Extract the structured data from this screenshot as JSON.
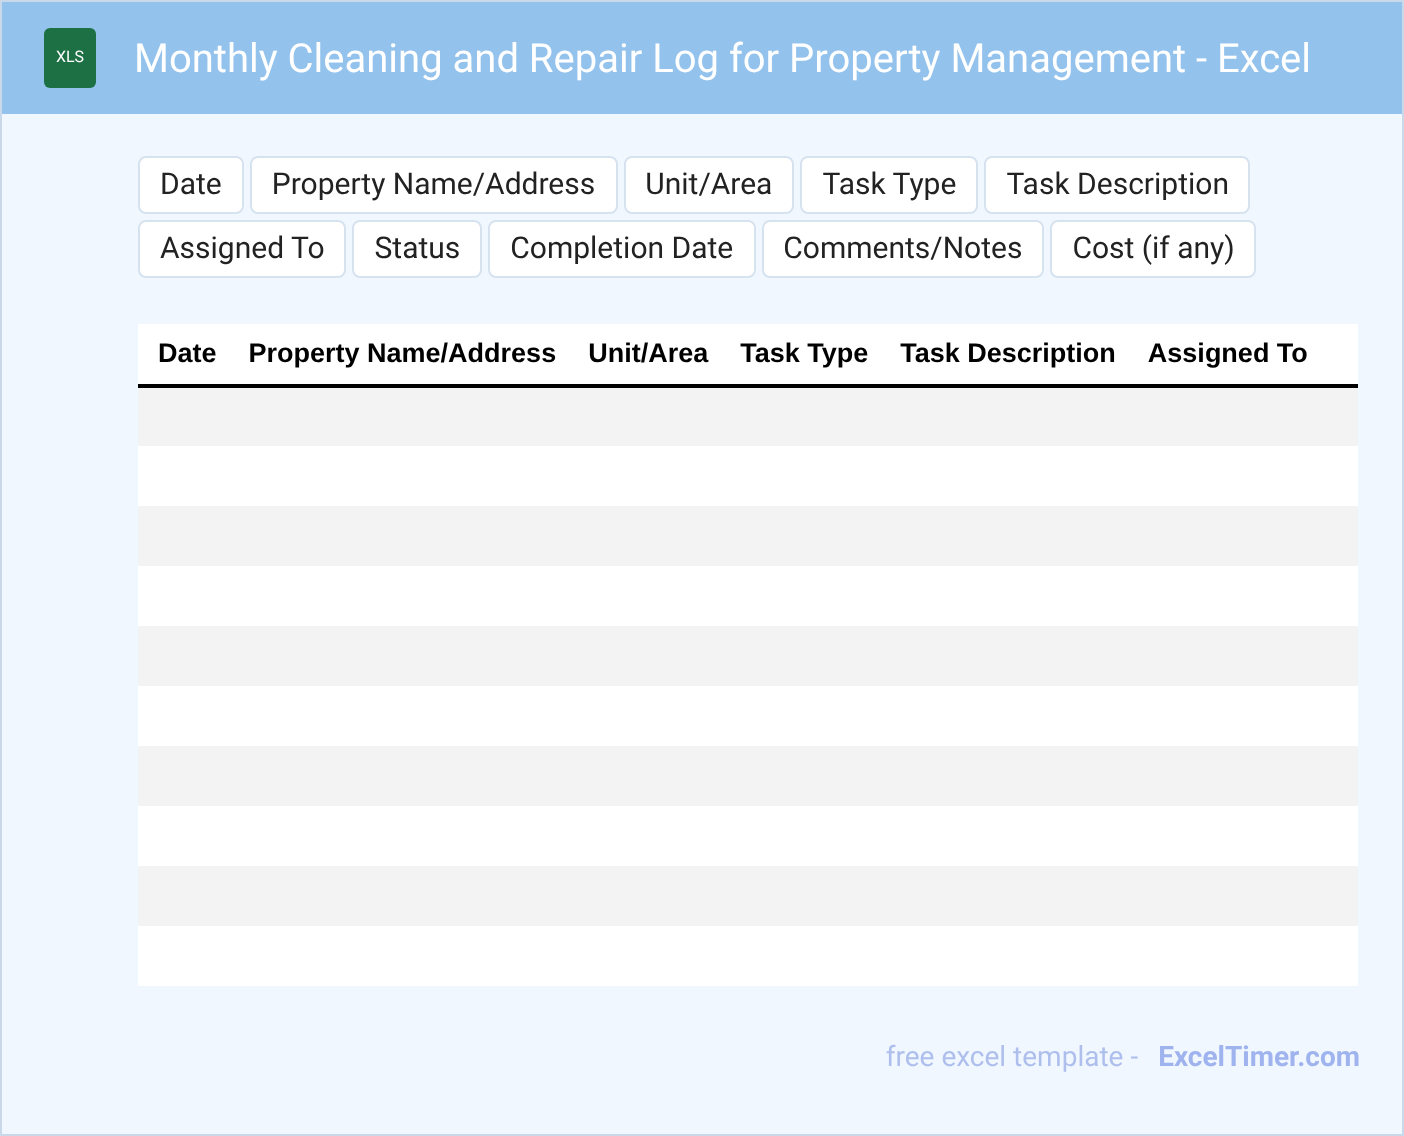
{
  "header": {
    "file_badge": "XLS",
    "title": "Monthly Cleaning and Repair Log for Property Management - Excel"
  },
  "field_chips": [
    "Date",
    "Property Name/Address",
    "Unit/Area",
    "Task Type",
    "Task Description",
    "Assigned To",
    "Status",
    "Completion Date",
    "Comments/Notes",
    "Cost (if any)"
  ],
  "table": {
    "columns": [
      "Date",
      "Property Name/Address",
      "Unit/Area",
      "Task Type",
      "Task Description",
      "Assigned To"
    ],
    "rows": [
      {
        "kind": "blank"
      },
      {
        "kind": "blank"
      },
      {
        "kind": "blank"
      },
      {
        "kind": "blank"
      },
      {
        "kind": "blank"
      },
      {
        "kind": "blank"
      },
      {
        "kind": "blank"
      },
      {
        "kind": "blank"
      },
      {
        "kind": "blank"
      },
      {
        "kind": "blank"
      }
    ]
  },
  "footer": {
    "text": "free excel template -",
    "link": "ExcelTimer.com"
  }
}
